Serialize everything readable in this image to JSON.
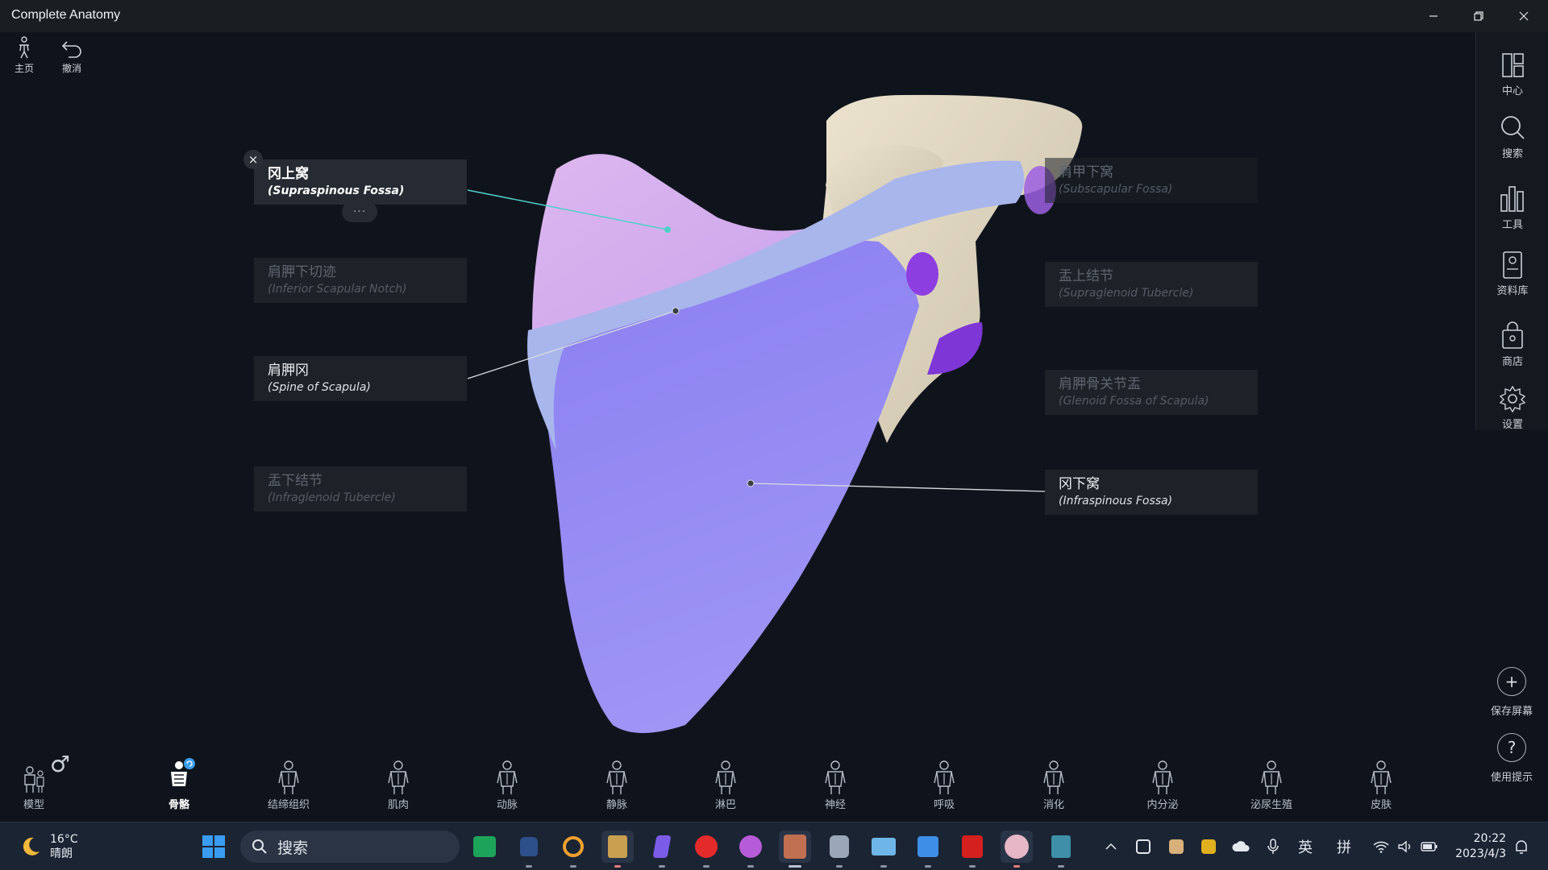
{
  "window": {
    "title": "Complete Anatomy",
    "min_icon": "minimize-icon",
    "max_icon": "restore-icon",
    "close_icon": "close-icon"
  },
  "top_tools": [
    {
      "label": "主页",
      "icon": "home-figure-icon"
    },
    {
      "label": "撤消",
      "icon": "undo-icon"
    }
  ],
  "right_sidebar": [
    {
      "label": "中心",
      "icon": "layout-icon"
    },
    {
      "label": "搜索",
      "icon": "search-icon"
    },
    {
      "label": "工具",
      "icon": "tools-icon"
    },
    {
      "label": "资料库",
      "icon": "library-icon"
    },
    {
      "label": "商店",
      "icon": "store-icon"
    },
    {
      "label": "设置",
      "icon": "gear-icon"
    }
  ],
  "side_actions": {
    "save_screen": {
      "label": "保存屏幕",
      "symbol": "+"
    },
    "help": {
      "label": "使用提示",
      "symbol": "?"
    }
  },
  "labels": {
    "supraspinous": {
      "cn": "冈上窝",
      "en": "(Supraspinous Fossa)"
    },
    "inferior_notch": {
      "cn": "肩胛下切迹",
      "en": "(Inferior Scapular Notch)"
    },
    "spine": {
      "cn": "肩胛冈",
      "en": "(Spine of Scapula)"
    },
    "infraglenoid": {
      "cn": "盂下结节",
      "en": "(Infraglenoid Tubercle)"
    },
    "subscapular": {
      "cn": "肩甲下窝",
      "en": "(Subscapular Fossa)"
    },
    "supraglenoid": {
      "cn": "盂上结节",
      "en": "(Supraglenoid Tubercle)"
    },
    "glenoid": {
      "cn": "肩胛骨关节盂",
      "en": "(Glenoid Fossa of Scapula)"
    },
    "infraspinous": {
      "cn": "冈下窝",
      "en": "(Infraspinous Fossa)"
    }
  },
  "label_controls": {
    "close": "×",
    "more": "···"
  },
  "systems": [
    {
      "label": "模型",
      "icon": "model-icon"
    },
    {
      "label": "骨骼",
      "icon": "skeleton-icon",
      "active": true
    },
    {
      "label": "结缔组织",
      "icon": "connective-tissue-icon"
    },
    {
      "label": "肌肉",
      "icon": "muscle-icon"
    },
    {
      "label": "动脉",
      "icon": "artery-icon"
    },
    {
      "label": "静脉",
      "icon": "vein-icon"
    },
    {
      "label": "淋巴",
      "icon": "lymph-icon"
    },
    {
      "label": "神经",
      "icon": "nerve-icon"
    },
    {
      "label": "呼吸",
      "icon": "respiratory-icon"
    },
    {
      "label": "消化",
      "icon": "digestive-icon"
    },
    {
      "label": "内分泌",
      "icon": "endocrine-icon"
    },
    {
      "label": "泌尿生殖",
      "icon": "urogenital-icon"
    },
    {
      "label": "皮肤",
      "icon": "skin-icon"
    }
  ],
  "gender_symbol": "♂",
  "taskbar": {
    "weather_temp": "16°C",
    "weather_desc": "晴朗",
    "search_placeholder": "搜索",
    "ime_lang": "英",
    "ime_mode": "拼",
    "time": "20:22",
    "date": "2023/4/3"
  }
}
